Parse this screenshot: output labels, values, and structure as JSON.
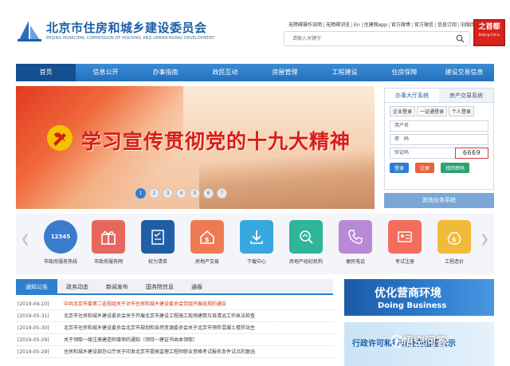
{
  "header": {
    "title": "北京市住房和城乡建设委员会",
    "subtitle": "BEIJING MUNICIPAL COMMISSION OF HOUSING AND URBAN-RURAL DEVELOPMENT",
    "toplinks": [
      "无障碍操作说明",
      "无障碍浏览",
      "En",
      "住建网app",
      "官方微博",
      "官方微信",
      "信息订阅",
      "旧版回顾"
    ],
    "search_placeholder": "请输入关键字",
    "seal_text": "之首都",
    "seal_sub": "Beijing-China"
  },
  "nav": {
    "items": [
      "首页",
      "信息公开",
      "办事指南",
      "政民互动",
      "房屋管理",
      "工程建设",
      "住房保障",
      "建设交易信息"
    ]
  },
  "banner": {
    "slogan": "学习宣传贯彻党的十九大精神",
    "pages": [
      "1",
      "2",
      "3",
      "4",
      "5",
      "6",
      "7"
    ],
    "active_page": 0
  },
  "login": {
    "tabs": [
      "办事大厅系统",
      "房产交易系统"
    ],
    "sub_tabs": [
      "企业登录",
      "一证通登录",
      "个人登录"
    ],
    "username_label": "用户名",
    "password_label": "密　码",
    "captcha_label": "验证码",
    "captcha_value": "6669",
    "login_btn": "登录",
    "register_btn": "注册",
    "forgot_btn": "找回密码",
    "other_systems": "其他业务系统"
  },
  "services": [
    {
      "label": "市政府服务热线",
      "icon": "12345",
      "color": "#3a7ccc"
    },
    {
      "label": "市政务服务网",
      "icon": "gift-icon",
      "color": "#e8675d"
    },
    {
      "label": "权力清单",
      "icon": "checklist-icon",
      "color": "#1f5fa8"
    },
    {
      "label": "房地产交易",
      "icon": "house-money-icon",
      "color": "#ee7a54"
    },
    {
      "label": "下载中心",
      "icon": "download-icon",
      "color": "#37a7e0"
    },
    {
      "label": "房地产经纪机构",
      "icon": "house-search-icon",
      "color": "#2fb59a"
    },
    {
      "label": "便民电话",
      "icon": "phone-icon",
      "color": "#b889d6"
    },
    {
      "label": "考试注册",
      "icon": "id-card-icon",
      "color": "#f26d5b"
    },
    {
      "label": "工程造价",
      "icon": "money-bag-icon",
      "color": "#f0bb3a"
    }
  ],
  "notices": {
    "tabs": [
      "通知公告",
      "政务动态",
      "新闻发布",
      "国务院信息",
      "通报"
    ],
    "items": [
      {
        "date": "[2019-04-10]",
        "title": "中共北京市委第二巡视组关于对市住房和城乡建设委员会党组开展巡视的通告",
        "highlight": true
      },
      {
        "date": "[2019-05-31]",
        "title": "北京市住房和城乡建设委员会关于开展北京市建设工程施工现场建筑垃圾清运工作执法检查",
        "highlight": false
      },
      {
        "date": "[2019-05-30]",
        "title": "北京市住房和城乡建设委员会北京市规划和自然资源委员会关于北京市预拌混凝土搅拌站生",
        "highlight": false
      },
      {
        "date": "[2019-05-29]",
        "title": "关于领取一级注册建造师增项的通知（领持一建证书由本领取）",
        "highlight": false
      },
      {
        "date": "[2019-05-29]",
        "title": "住房和城乡建设部办公厅关于印发北京市提高监理工程师职业资格考试报名条件试点的复函",
        "highlight": false
      }
    ]
  },
  "promo": {
    "cn": "优化营商环境",
    "en": "Doing Business",
    "second": "行政许可和行政处罚信息公示"
  },
  "watermark": "悟空问答",
  "colors": {
    "primary": "#2f7fd0",
    "nav_active": "#154f8f",
    "highlight_red": "#d1281d"
  }
}
